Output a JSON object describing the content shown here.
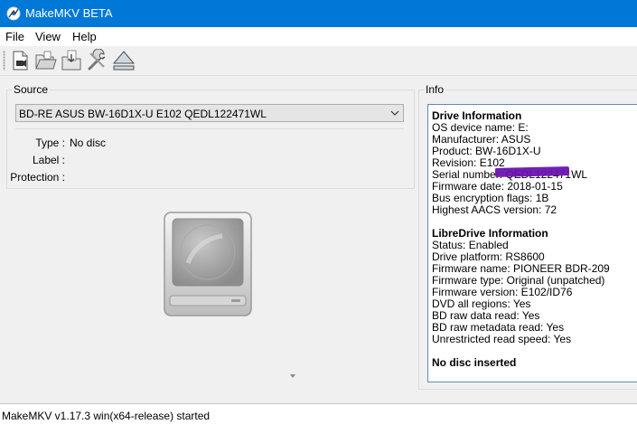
{
  "window": {
    "title": "MakeMKV BETA"
  },
  "menu": {
    "items": [
      "File",
      "View",
      "Help"
    ]
  },
  "toolbar": {
    "buttons": [
      "open-files-icon",
      "open-disc-icon",
      "backup-icon",
      "preferences-icon",
      "eject-icon"
    ]
  },
  "source": {
    "legend": "Source",
    "drive_selected": "BD-RE ASUS BW-16D1X-U E102 QEDL122471WL",
    "props": [
      {
        "label": "Type :",
        "value": "No disc"
      },
      {
        "label": "Label :",
        "value": ""
      },
      {
        "label": "Protection :",
        "value": ""
      }
    ]
  },
  "info": {
    "legend": "Info",
    "lines": [
      {
        "text": "Drive Information",
        "bold": true
      },
      {
        "text": "OS device name: E:",
        "bold": false
      },
      {
        "text": "Manufacturer: ASUS",
        "bold": false
      },
      {
        "text": "Product: BW-16D1X-U",
        "bold": false
      },
      {
        "text": "Revision: E102",
        "bold": false
      },
      {
        "text": "Serial number: QEDL122471WL",
        "bold": false
      },
      {
        "text": "Firmware date: 2018-01-15",
        "bold": false
      },
      {
        "text": "Bus encryption flags: 1B",
        "bold": false
      },
      {
        "text": "Highest AACS version: 72",
        "bold": false
      },
      {
        "text": "LibreDrive Information",
        "bold": true
      },
      {
        "text": "Status: Enabled",
        "bold": false
      },
      {
        "text": "Drive platform: RS8600",
        "bold": false
      },
      {
        "text": "Firmware name: PIONEER BDR-209",
        "bold": false
      },
      {
        "text": "Firmware type: Original (unpatched)",
        "bold": false
      },
      {
        "text": "Firmware version: E102/ID76",
        "bold": false
      },
      {
        "text": "DVD all regions: Yes",
        "bold": false
      },
      {
        "text": "BD raw data read: Yes",
        "bold": false
      },
      {
        "text": "BD raw metadata read: Yes",
        "bold": false
      },
      {
        "text": "Unrestricted read speed: Yes",
        "bold": false
      },
      {
        "text": "No disc inserted",
        "bold": true
      }
    ]
  },
  "status": {
    "text": "MakeMKV v1.17.3 win(x64-release) started"
  },
  "colors": {
    "titlebar": "#0078d7",
    "info_border": "#5a8bc0",
    "redaction": "#6a13b0"
  }
}
